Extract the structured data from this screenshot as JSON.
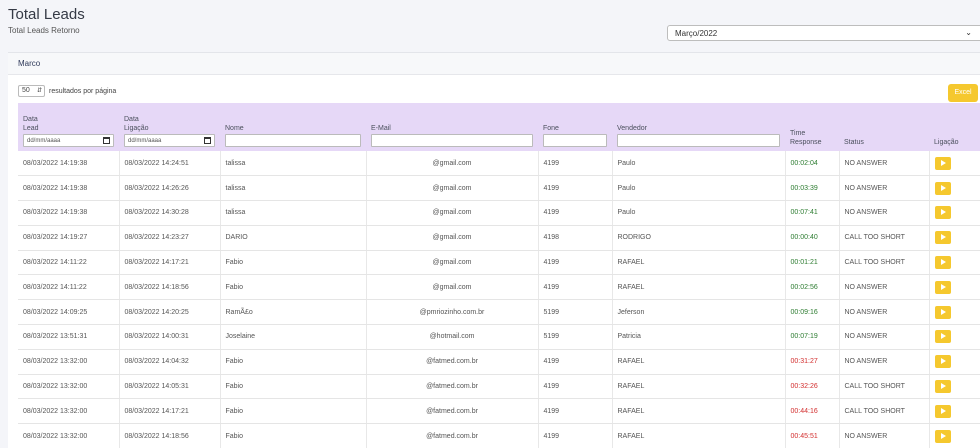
{
  "header": {
    "title": "Total Leads",
    "subtitle": "Total Leads Retorno"
  },
  "month_filter": {
    "selected": "Março/2022"
  },
  "card": {
    "title": "Marco"
  },
  "pagination": {
    "per_page": "50",
    "per_page_label": "resultados por página"
  },
  "excel_label": "Excel",
  "columns": {
    "data_lead": [
      "Data",
      "Lead"
    ],
    "data_ligacao": [
      "Data",
      "Ligação"
    ],
    "nome": "Nome",
    "email": "E-Mail",
    "fone": "Fone",
    "vendedor": "Vendedor",
    "time_response": [
      "Time",
      "Response"
    ],
    "status": "Status",
    "ligacao": "Ligação"
  },
  "date_placeholder": "dd/mm/aaaa",
  "rows": [
    {
      "data_lead": "08/03/2022 14:19:38",
      "data_ligacao": "08/03/2022 14:24:51",
      "nome": "talissa",
      "email": "@gmail.com",
      "fone": "4199",
      "vendedor": "Paulo",
      "time": "00:02:04",
      "status": "NO ANSWER",
      "late": false
    },
    {
      "data_lead": "08/03/2022 14:19:38",
      "data_ligacao": "08/03/2022 14:26:26",
      "nome": "talissa",
      "email": "@gmail.com",
      "fone": "4199",
      "vendedor": "Paulo",
      "time": "00:03:39",
      "status": "NO ANSWER",
      "late": false
    },
    {
      "data_lead": "08/03/2022 14:19:38",
      "data_ligacao": "08/03/2022 14:30:28",
      "nome": "talissa",
      "email": "@gmail.com",
      "fone": "4199",
      "vendedor": "Paulo",
      "time": "00:07:41",
      "status": "NO ANSWER",
      "late": false
    },
    {
      "data_lead": "08/03/2022 14:19:27",
      "data_ligacao": "08/03/2022 14:23:27",
      "nome": "DARIO",
      "email": "@gmail.com",
      "fone": "4198",
      "vendedor": "RODRIGO",
      "time": "00:00:40",
      "status": "CALL TOO SHORT",
      "late": false
    },
    {
      "data_lead": "08/03/2022 14:11:22",
      "data_ligacao": "08/03/2022 14:17:21",
      "nome": "Fabio",
      "email": "@gmail.com",
      "fone": "4199",
      "vendedor": "RAFAEL",
      "time": "00:01:21",
      "status": "CALL TOO SHORT",
      "late": false
    },
    {
      "data_lead": "08/03/2022 14:11:22",
      "data_ligacao": "08/03/2022 14:18:56",
      "nome": "Fabio",
      "email": "@gmail.com",
      "fone": "4199",
      "vendedor": "RAFAEL",
      "time": "00:02:56",
      "status": "NO ANSWER",
      "late": false
    },
    {
      "data_lead": "08/03/2022 14:09:25",
      "data_ligacao": "08/03/2022 14:20:25",
      "nome": "RamÃ£o",
      "email": "@pmriozinho.com.br",
      "fone": "5199",
      "vendedor": "Jeferson",
      "time": "00:09:16",
      "status": "NO ANSWER",
      "late": false
    },
    {
      "data_lead": "08/03/2022 13:51:31",
      "data_ligacao": "08/03/2022 14:00:31",
      "nome": "Joselaine",
      "email": "@hotmail.com",
      "fone": "5199",
      "vendedor": "Patricia",
      "time": "00:07:19",
      "status": "NO ANSWER",
      "late": false
    },
    {
      "data_lead": "08/03/2022 13:32:00",
      "data_ligacao": "08/03/2022 14:04:32",
      "nome": "Fabio",
      "email": "@fatmed.com.br",
      "fone": "4199",
      "vendedor": "RAFAEL",
      "time": "00:31:27",
      "status": "NO ANSWER",
      "late": true
    },
    {
      "data_lead": "08/03/2022 13:32:00",
      "data_ligacao": "08/03/2022 14:05:31",
      "nome": "Fabio",
      "email": "@fatmed.com.br",
      "fone": "4199",
      "vendedor": "RAFAEL",
      "time": "00:32:26",
      "status": "CALL TOO SHORT",
      "late": true
    },
    {
      "data_lead": "08/03/2022 13:32:00",
      "data_ligacao": "08/03/2022 14:17:21",
      "nome": "Fabio",
      "email": "@fatmed.com.br",
      "fone": "4199",
      "vendedor": "RAFAEL",
      "time": "00:44:16",
      "status": "CALL TOO SHORT",
      "late": true
    },
    {
      "data_lead": "08/03/2022 13:32:00",
      "data_ligacao": "08/03/2022 14:18:56",
      "nome": "Fabio",
      "email": "@fatmed.com.br",
      "fone": "4199",
      "vendedor": "RAFAEL",
      "time": "00:45:51",
      "status": "NO ANSWER",
      "late": true
    }
  ],
  "colors": {
    "accent": "#f5c82e",
    "header_bg": "#e6d8f7",
    "ok": "#2e7d32",
    "late": "#d32f2f"
  },
  "icons": {
    "play": "play-icon",
    "calendar": "calendar-icon",
    "chevron": "chevron-down-icon"
  }
}
